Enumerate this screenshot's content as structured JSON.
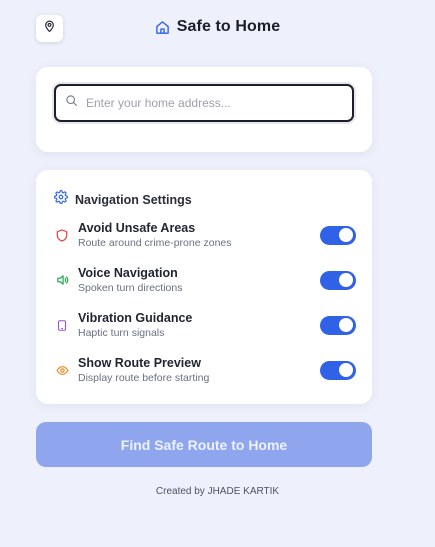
{
  "header": {
    "title": "Safe to Home",
    "location_icon": "map-pin-icon",
    "home_icon": "home-icon"
  },
  "search": {
    "placeholder": "Enter your home address...",
    "value": "",
    "icon": "search-icon"
  },
  "settings": {
    "title": "Navigation Settings",
    "icon": "gear-icon",
    "items": [
      {
        "label": "Avoid Unsafe Areas",
        "description": "Route around crime-prone zones",
        "icon": "shield-icon",
        "icon_color": "#e04a4a",
        "enabled": true
      },
      {
        "label": "Voice Navigation",
        "description": "Spoken turn directions",
        "icon": "speaker-icon",
        "icon_color": "#2faa55",
        "enabled": true
      },
      {
        "label": "Vibration Guidance",
        "description": "Haptic turn signals",
        "icon": "phone-vibrate-icon",
        "icon_color": "#9b4fd6",
        "enabled": true
      },
      {
        "label": "Show Route Preview",
        "description": "Display route before starting",
        "icon": "eye-icon",
        "icon_color": "#f08a24",
        "enabled": true
      }
    ]
  },
  "cta": {
    "label": "Find Safe Route to Home"
  },
  "footer": {
    "text": "Created by JHADE KARTIK"
  },
  "colors": {
    "background": "#eef1fb",
    "accent": "#2f62e6",
    "button_disabled": "#8fa6ee"
  }
}
